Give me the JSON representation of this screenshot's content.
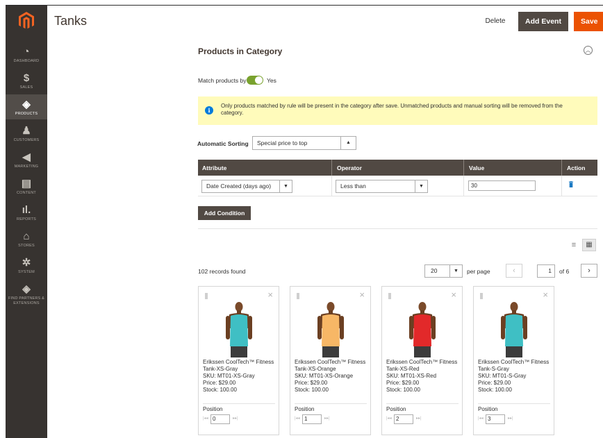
{
  "sidebar": {
    "logo_icon": "magento-logo",
    "items": [
      {
        "label": "DASHBOARD",
        "icon": "dashboard-icon",
        "glyph": "◔"
      },
      {
        "label": "SALES",
        "icon": "dollar-icon",
        "glyph": "$"
      },
      {
        "label": "PRODUCTS",
        "icon": "cube-icon",
        "glyph": "◈"
      },
      {
        "label": "CUSTOMERS",
        "icon": "person-icon",
        "glyph": "♟"
      },
      {
        "label": "MARKETING",
        "icon": "megaphone-icon",
        "glyph": "◀"
      },
      {
        "label": "CONTENT",
        "icon": "content-icon",
        "glyph": "▤"
      },
      {
        "label": "REPORTS",
        "icon": "bar-chart-icon",
        "glyph": "ıl."
      },
      {
        "label": "STORES",
        "icon": "store-icon",
        "glyph": "⌂"
      },
      {
        "label": "SYSTEM",
        "icon": "gear-icon",
        "glyph": "✲"
      },
      {
        "label": "FIND PARTNERS & EXTENSIONS",
        "icon": "extensions-icon",
        "glyph": "◈"
      }
    ],
    "active_index": 2
  },
  "header": {
    "title": "Tanks",
    "delete_label": "Delete",
    "add_event_label": "Add Event",
    "save_label": "Save"
  },
  "section": {
    "title": "Products in Category",
    "match_label": "Match products by rule",
    "match_value": "Yes",
    "notice": "Only products matched by rule will be present in the category after save. Unmatched products and manual sorting will be removed from the category.",
    "sort_label": "Automatic Sorting",
    "sort_value": "Special price to top"
  },
  "conditions": {
    "headers": {
      "attribute": "Attribute",
      "operator": "Operator",
      "value": "Value",
      "action": "Action"
    },
    "rows": [
      {
        "attribute": "Date Created (days ago)",
        "operator": "Less than",
        "value": "30"
      }
    ],
    "add_label": "Add Condition"
  },
  "grid": {
    "records": "102 records found",
    "per_page_value": "20",
    "per_page_label": "per page",
    "current_page": "1",
    "of_pages": "of 6"
  },
  "products": [
    {
      "name": "Erikssen CoolTech™ Fitness Tank-XS-Gray",
      "sku": "SKU: MT01-XS-Gray",
      "price": "Price: $29.00",
      "stock": "Stock: 100.00",
      "position_label": "Position",
      "position": "0",
      "shirt_color": "#3fbfc4"
    },
    {
      "name": "Erikssen CoolTech™ Fitness Tank-XS-Orange",
      "sku": "SKU: MT01-XS-Orange",
      "price": "Price: $29.00",
      "stock": "Stock: 100.00",
      "position_label": "Position",
      "position": "1",
      "shirt_color": "#f7b766"
    },
    {
      "name": "Erikssen CoolTech™ Fitness Tank-XS-Red",
      "sku": "SKU: MT01-XS-Red",
      "price": "Price: $29.00",
      "stock": "Stock: 100.00",
      "position_label": "Position",
      "position": "2",
      "shirt_color": "#e2292a"
    },
    {
      "name": "Erikssen CoolTech™ Fitness Tank-S-Gray",
      "sku": "SKU: MT01-S-Gray",
      "price": "Price: $29.00",
      "stock": "Stock: 100.00",
      "position_label": "Position",
      "position": "3",
      "shirt_color": "#3fbfc4"
    }
  ],
  "colors": {
    "accent": "#eb5202",
    "dark": "#514943",
    "toggle_on": "#79a22e",
    "notice_bg": "#fffbbb"
  }
}
